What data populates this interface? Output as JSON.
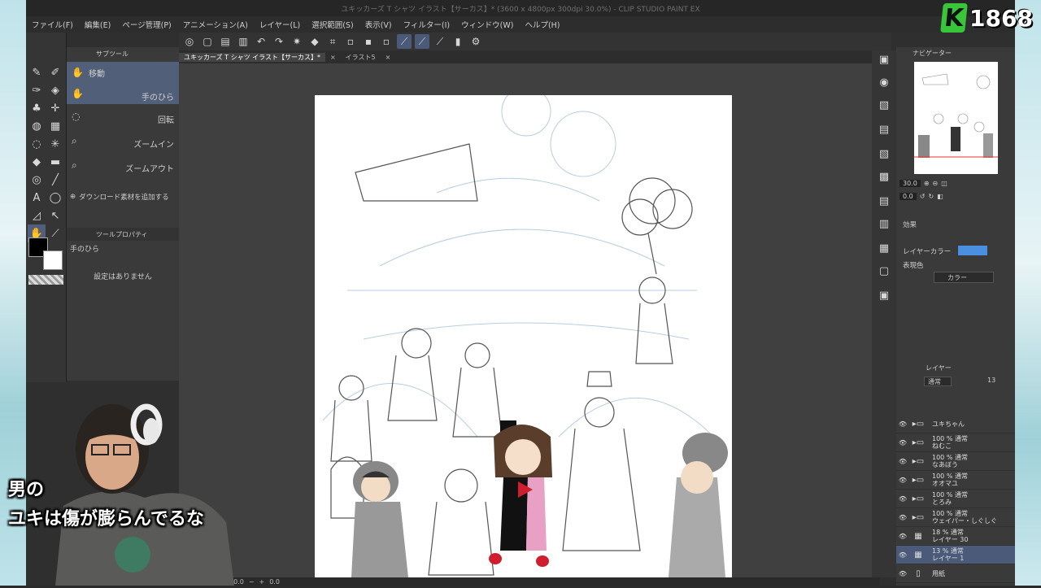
{
  "app": {
    "title": "ユキッカーズ T シャツ イラスト【サーカス】* (3600 x 4800px 300dpi 30.0%) - CLIP STUDIO PAINT EX"
  },
  "menu": [
    "ファイル(F)",
    "編集(E)",
    "ページ管理(P)",
    "アニメーション(A)",
    "レイヤー(L)",
    "選択範囲(S)",
    "表示(V)",
    "フィルター(I)",
    "ウィンドウ(W)",
    "ヘルプ(H)"
  ],
  "subtool": {
    "header": "サブツール",
    "items": [
      {
        "label": "移動"
      },
      {
        "label": "手のひら"
      },
      {
        "label": "回転"
      },
      {
        "label": "ズームイン"
      },
      {
        "label": "ズームアウト"
      }
    ],
    "add_material": "ダウンロード素材を追加する"
  },
  "tool_property": {
    "header": "ツールプロパティ",
    "tool_name": "手のひら",
    "empty_text": "設定はありません"
  },
  "tabs": [
    {
      "label": "ユキッカーズ T シャツ イラスト【サーカス】*"
    },
    {
      "label": "イラスト5"
    }
  ],
  "status": {
    "zoom": "30.0",
    "angle": "0.0"
  },
  "navigator": {
    "title": "ナビゲーター",
    "zoom": "30.0",
    "angle": "0.0"
  },
  "layer_property": {
    "effect_label": "効果",
    "layer_color_label": "レイヤーカラー",
    "expression_color_label": "表現色",
    "expression_color_value": "カラー",
    "layer_color": "#4a8fe0"
  },
  "layers_panel": {
    "title": "レイヤー",
    "blend_mode": "通常",
    "opacity": "13"
  },
  "layers": [
    {
      "opacity_mode": "",
      "name": "ユキちゃん",
      "type": "folder"
    },
    {
      "opacity_mode": "100 % 通常",
      "name": "ねむこ",
      "type": "folder"
    },
    {
      "opacity_mode": "100 % 通常",
      "name": "なあぼう",
      "type": "folder"
    },
    {
      "opacity_mode": "100 % 通常",
      "name": "オオマユ",
      "type": "folder"
    },
    {
      "opacity_mode": "100 % 通常",
      "name": "とろみ",
      "type": "folder"
    },
    {
      "opacity_mode": "100 % 通常",
      "name": "ウェイパー・しぐしぐ",
      "type": "folder"
    },
    {
      "opacity_mode": "18 % 通常",
      "name": "レイヤー 30",
      "type": "raster"
    },
    {
      "opacity_mode": "13 % 通常",
      "name": "レイヤー 1",
      "type": "raster",
      "selected": true
    },
    {
      "opacity_mode": "",
      "name": "用紙",
      "type": "paper"
    }
  ],
  "caption": {
    "line1": "男の",
    "line2": "ユキは傷が膨らんでるな"
  },
  "logo": {
    "letter": "K",
    "number": "1868"
  }
}
